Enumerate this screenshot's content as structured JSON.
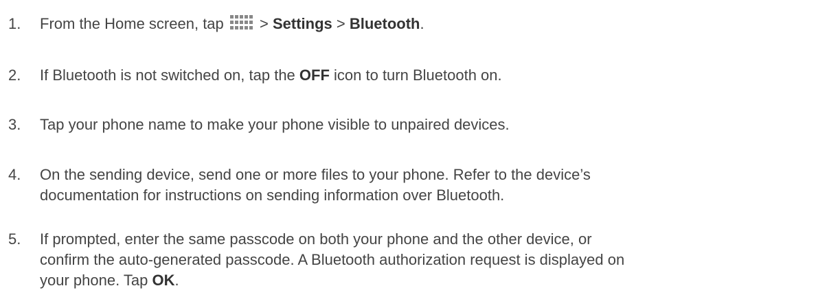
{
  "steps": [
    {
      "number": "1.",
      "parts": {
        "a": "From the Home screen, tap ",
        "icon": "apps-grid-icon",
        "b": " > ",
        "c": "Settings",
        "d": " > ",
        "e": "Bluetooth",
        "f": "."
      }
    },
    {
      "number": "2.",
      "parts": {
        "a": "If Bluetooth is not switched on, tap the ",
        "b": "OFF",
        "c": " icon to turn Bluetooth on."
      }
    },
    {
      "number": "3.",
      "text": "Tap your phone name to make your phone visible to unpaired devices."
    },
    {
      "number": "4.",
      "lines": [
        "On the sending device, send one or more files to your phone. Refer to the device’s",
        "documentation for instructions on sending information over Bluetooth."
      ]
    },
    {
      "number": "5.",
      "lines": [
        "If prompted, enter the same passcode on both your phone and the other device, or",
        "confirm the auto-generated passcode. A Bluetooth authorization request is displayed on"
      ],
      "last_line": {
        "a": "your phone. Tap ",
        "b": "OK",
        "c": "."
      }
    }
  ]
}
